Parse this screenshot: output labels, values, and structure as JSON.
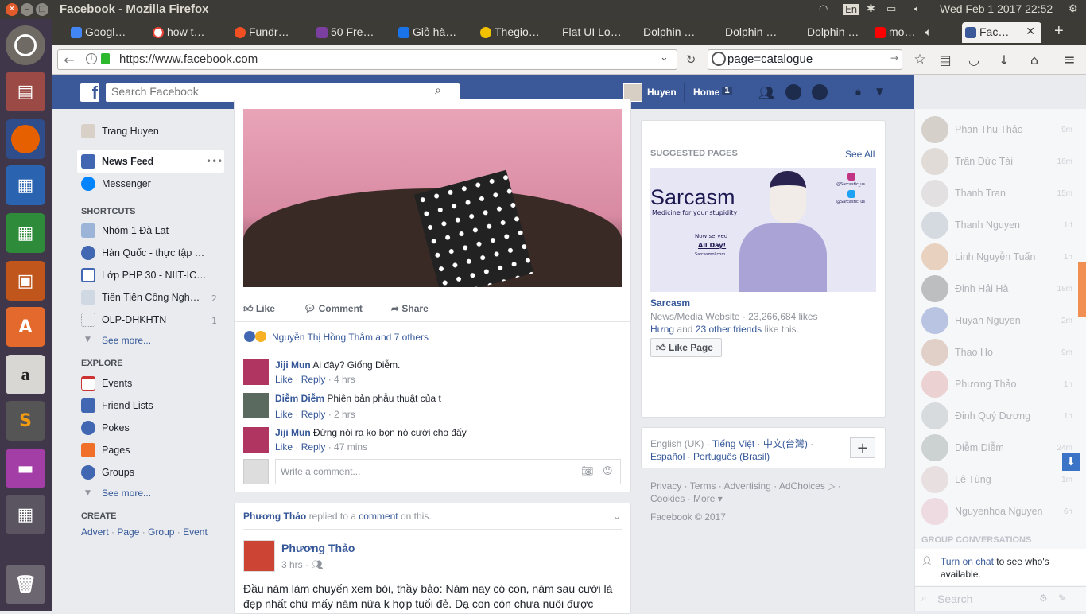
{
  "system": {
    "window_title": "Facebook - Mozilla Firefox",
    "keyboard": "En",
    "datetime": "Wed Feb  1 2017 22:52"
  },
  "browser": {
    "tabs": [
      {
        "label": "Googl…",
        "color": "#4285f4"
      },
      {
        "label": "how t…",
        "color": "#ea4335"
      },
      {
        "label": "Fundr…",
        "color": "#f25022"
      },
      {
        "label": "50 Fre…",
        "color": "#7b3fa0"
      },
      {
        "label": "Giỏ hà…",
        "color": "#1a73e8"
      },
      {
        "label": "Thegio…",
        "color": "#f2c200"
      },
      {
        "label": "Flat UI Lo…",
        "color": "#3d3b36"
      },
      {
        "label": "Dolphin …",
        "color": "#3d3b36"
      },
      {
        "label": "Dolphin …",
        "color": "#3d3b36"
      },
      {
        "label": "Dolphin …",
        "color": "#3d3b36"
      },
      {
        "label": "mo…",
        "color": "#ff0000"
      },
      {
        "label": "Fac…",
        "color": "#3b5998"
      }
    ],
    "url": "https://www.facebook.com",
    "search_value": "page=catalogue"
  },
  "fb": {
    "search_placeholder": "Search Facebook",
    "user_name": "Huyen",
    "home_label": "Home",
    "home_count": "1"
  },
  "left": {
    "profile_name": "Trang Huyen",
    "news_feed": "News Feed",
    "messenger": "Messenger",
    "shortcuts_title": "SHORTCUTS",
    "shortcuts": [
      {
        "label": "Nhóm 1 Đà Lạt",
        "count": ""
      },
      {
        "label": "Hàn Quốc - thực tập …",
        "count": ""
      },
      {
        "label": "Lớp PHP 30 - NIIT-IC…",
        "count": ""
      },
      {
        "label": "Tiên Tiến Công Ngh…",
        "count": "2"
      },
      {
        "label": "OLP-DHKHTN",
        "count": "1"
      }
    ],
    "see_more": "See more...",
    "explore_title": "EXPLORE",
    "explore": [
      {
        "label": "Events"
      },
      {
        "label": "Friend Lists"
      },
      {
        "label": "Pokes"
      },
      {
        "label": "Pages"
      },
      {
        "label": "Groups"
      }
    ],
    "see_more2": "See more...",
    "create_title": "CREATE",
    "create_links": [
      "Advert",
      "Page",
      "Group",
      "Event"
    ]
  },
  "post": {
    "like": "Like",
    "comment": "Comment",
    "share": "Share",
    "reactions": "Nguyễn Thị Hồng Thắm and 7 others",
    "comments": [
      {
        "author": "Jiji Mun",
        "text": "Ai đây? Giống Diễm.",
        "time": "4 hrs"
      },
      {
        "author": "Diễm Diễm",
        "text": "Phiên bản phẫu thuật của t",
        "time": "2 hrs"
      },
      {
        "author": "Jiji Mun",
        "text": "Đừng nói ra ko bọn nó cười cho đấy",
        "time": "47 mins"
      }
    ],
    "like_action": "Like",
    "reply_action": "Reply",
    "write_placeholder": "Write a comment..."
  },
  "post2": {
    "notif_author": "Phương Thảo",
    "notif_mid": "replied to a",
    "notif_link": "comment",
    "notif_end": "on this.",
    "author": "Phương Thảo",
    "time": "3 hrs",
    "text": "Đầu năm làm chuyến xem bói, thầy bảo: Năm nay có con, năm sau cưới là đẹp nhất chứ mấy năm nữa k hợp tuổi đẻ. Dạ con còn chưa nuôi được"
  },
  "suggested": {
    "title": "SUGGESTED PAGES",
    "see_all": "See All",
    "ad_title": "Sarcasm",
    "ad_tagline": "Medicine for your stupidity",
    "ad_served": "Now served",
    "ad_allday": "All Day!",
    "ad_site": "Sarcasmol.com",
    "ad_handle": "@Sarcastic_us",
    "page_name": "Sarcasm",
    "page_meta": "News/Media Website · 23,266,684 likes",
    "friend": "Hưng",
    "friends_mid": "and",
    "friends_link": "23 other friends",
    "friends_end": "like this.",
    "like_page": "Like Page"
  },
  "languages": {
    "current": "English (UK) ·",
    "list": [
      "Tiếng Việt",
      "中文(台灣)",
      "Español",
      "Português (Brasil)"
    ]
  },
  "footer": {
    "links": [
      "Privacy",
      "Terms",
      "Advertising",
      "AdChoices",
      "Cookies",
      "More"
    ],
    "copyright": "Facebook © 2017"
  },
  "chat": {
    "friends": [
      {
        "name": "Phan Thu Thảo",
        "time": "9m"
      },
      {
        "name": "Trần Đức Tài",
        "time": "16m"
      },
      {
        "name": "Thanh Tran",
        "time": "15m"
      },
      {
        "name": "Thanh Nguyen",
        "time": "1d"
      },
      {
        "name": "Linh Nguyễn Tuấn",
        "time": "1h"
      },
      {
        "name": "Đinh Hải Hà",
        "time": "18m"
      },
      {
        "name": "Huyan Nguyen",
        "time": "2m"
      },
      {
        "name": "Thao Ho",
        "time": "9m"
      },
      {
        "name": "Phương Thảo",
        "time": "1h"
      },
      {
        "name": "Đinh Quý Dương",
        "time": "1h"
      },
      {
        "name": "Diễm Diễm",
        "time": "24m"
      },
      {
        "name": "Lê Tùng",
        "time": "1m"
      },
      {
        "name": "Nguyenhoa Nguyen",
        "time": "6h"
      }
    ],
    "group_title": "GROUP CONVERSATIONS",
    "turn_on_link": "Turn on chat",
    "turn_on_rest": "to see who's available.",
    "search_placeholder": "Search"
  }
}
